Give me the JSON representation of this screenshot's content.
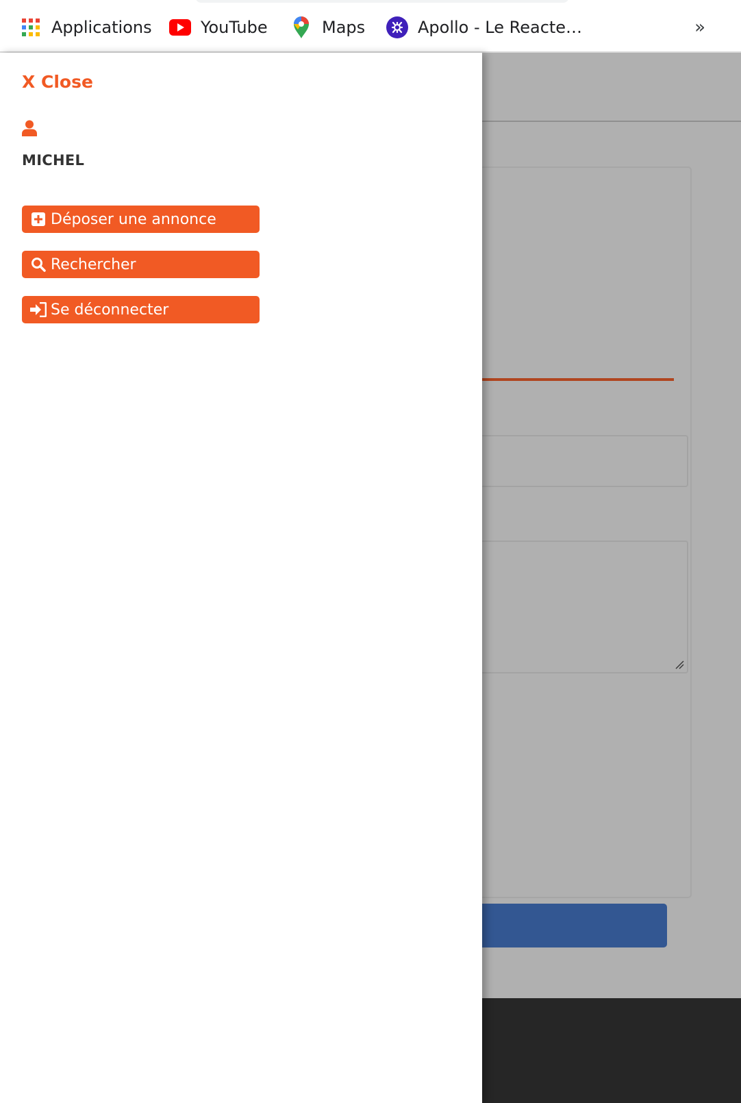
{
  "bookmarks": {
    "items": [
      {
        "label": "Applications",
        "icon": "apps-grid-icon"
      },
      {
        "label": "YouTube",
        "icon": "youtube-icon"
      },
      {
        "label": "Maps",
        "icon": "maps-pin-icon"
      },
      {
        "label": "Apollo - Le Reacte…",
        "icon": "apollo-icon"
      }
    ],
    "overflow_label": "»"
  },
  "drawer": {
    "close_label": "X Close",
    "user_icon": "user-icon",
    "username": "MICHEL",
    "menu": [
      {
        "label": "Déposer une annonce",
        "icon": "plus-square-icon"
      },
      {
        "label": "Rechercher",
        "icon": "search-icon"
      },
      {
        "label": "Se déconnecter",
        "icon": "sign-in-icon"
      }
    ]
  },
  "colors": {
    "accent": "#f15a24",
    "overlay": "#b0b0b0",
    "primary_button_bg": "#335792",
    "footer": "#262626",
    "username_text": "#333333"
  }
}
